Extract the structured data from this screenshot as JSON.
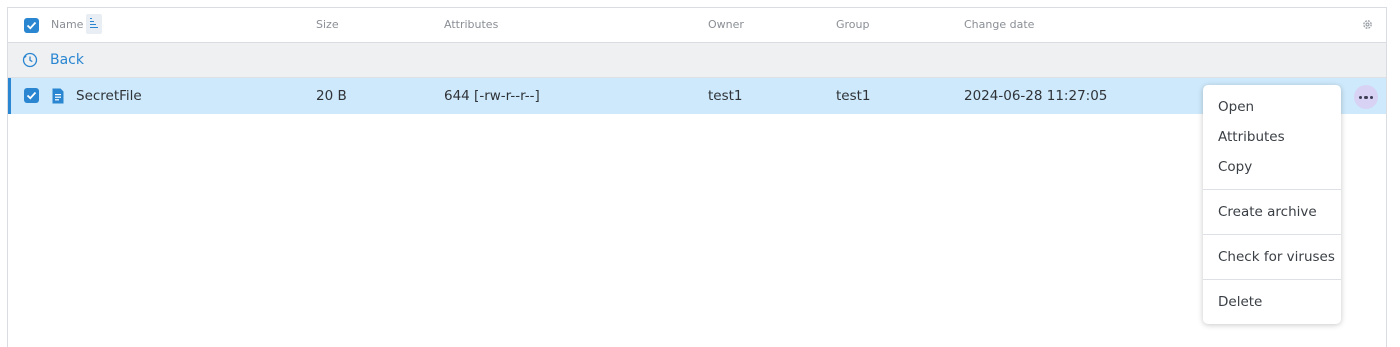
{
  "header": {
    "name": "Name",
    "size": "Size",
    "attributes": "Attributes",
    "owner": "Owner",
    "group": "Group",
    "change_date": "Change date"
  },
  "back": {
    "label": "Back"
  },
  "rows": [
    {
      "name": "SecretFile",
      "size": "20 B",
      "attributes": "644 [-rw-r--r--]",
      "owner": "test1",
      "group": "test1",
      "change_date": "2024-06-28 11:27:05",
      "selected": true
    }
  ],
  "context_menu": {
    "items": [
      "Open",
      "Attributes",
      "Copy",
      "Create archive",
      "Check for viruses",
      "Delete"
    ]
  },
  "colors": {
    "accent": "#2a86d1",
    "selected_row": "#cde9fb",
    "back_row": "#eef0f2"
  },
  "icons": {
    "select_all": "checkbox-checked-icon",
    "sort": "sort-icon",
    "settings": "gear-icon",
    "back": "back-icon",
    "file": "file-icon",
    "more": "more-icon"
  }
}
